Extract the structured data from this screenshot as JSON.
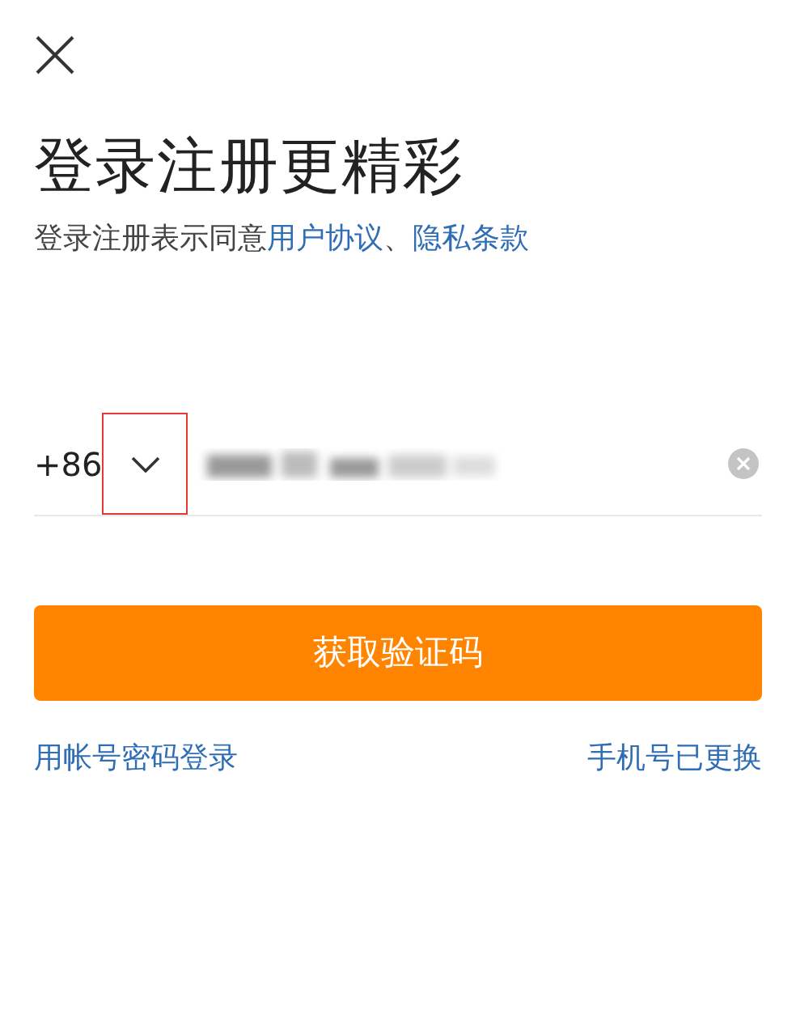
{
  "title": "登录注册更精彩",
  "agreement": {
    "prefix": "登录注册表示同意",
    "links": [
      "用户协议",
      "隐私条款"
    ],
    "separator": "、"
  },
  "phone": {
    "country_code": "+86",
    "dropdown_highlighted": true
  },
  "submit_button": "获取验证码",
  "links": {
    "left": "用帐号密码登录",
    "right": "手机号已更换"
  }
}
